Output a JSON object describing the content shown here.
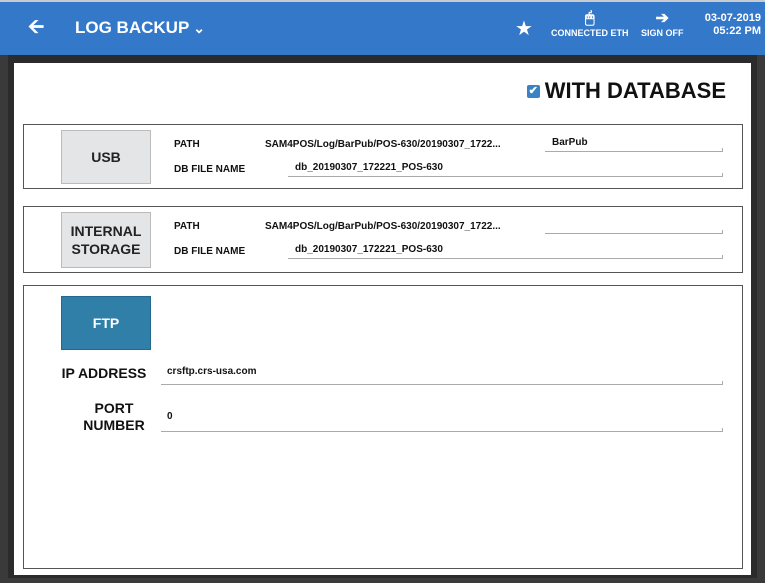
{
  "header": {
    "back_icon": "back-arrow-icon",
    "title": "LOG BACKUP",
    "dropdown_icon": "chevron-down-icon",
    "connection_label": "CONNECTED ETH",
    "signoff_label": "SIGN OFF",
    "date": "03-07-2019",
    "time": "05:22 PM"
  },
  "with_database": {
    "label": "WITH DATABASE",
    "checked": true
  },
  "usb": {
    "button": "USB",
    "path_label": "PATH",
    "path_value": "SAM4POS/Log/BarPub/POS-630/20190307_1722...",
    "folder_value": "BarPub",
    "dbfile_label": "DB FILE NAME",
    "dbfile_value": "db_20190307_172221_POS-630"
  },
  "internal": {
    "button_line1": "INTERNAL",
    "button_line2": "STORAGE",
    "path_label": "PATH",
    "path_value": "SAM4POS/Log/BarPub/POS-630/20190307_1722...",
    "folder_value": "",
    "dbfile_label": "DB FILE NAME",
    "dbfile_value": "db_20190307_172221_POS-630"
  },
  "ftp": {
    "button": "FTP",
    "ip_label": "IP ADDRESS",
    "ip_value": "crsftp.crs-usa.com",
    "port_label_line1": "PORT",
    "port_label_line2": "NUMBER",
    "port_value": "0"
  },
  "colors": {
    "header_bg": "#3478c9",
    "ftp_active": "#2f7fa8"
  }
}
